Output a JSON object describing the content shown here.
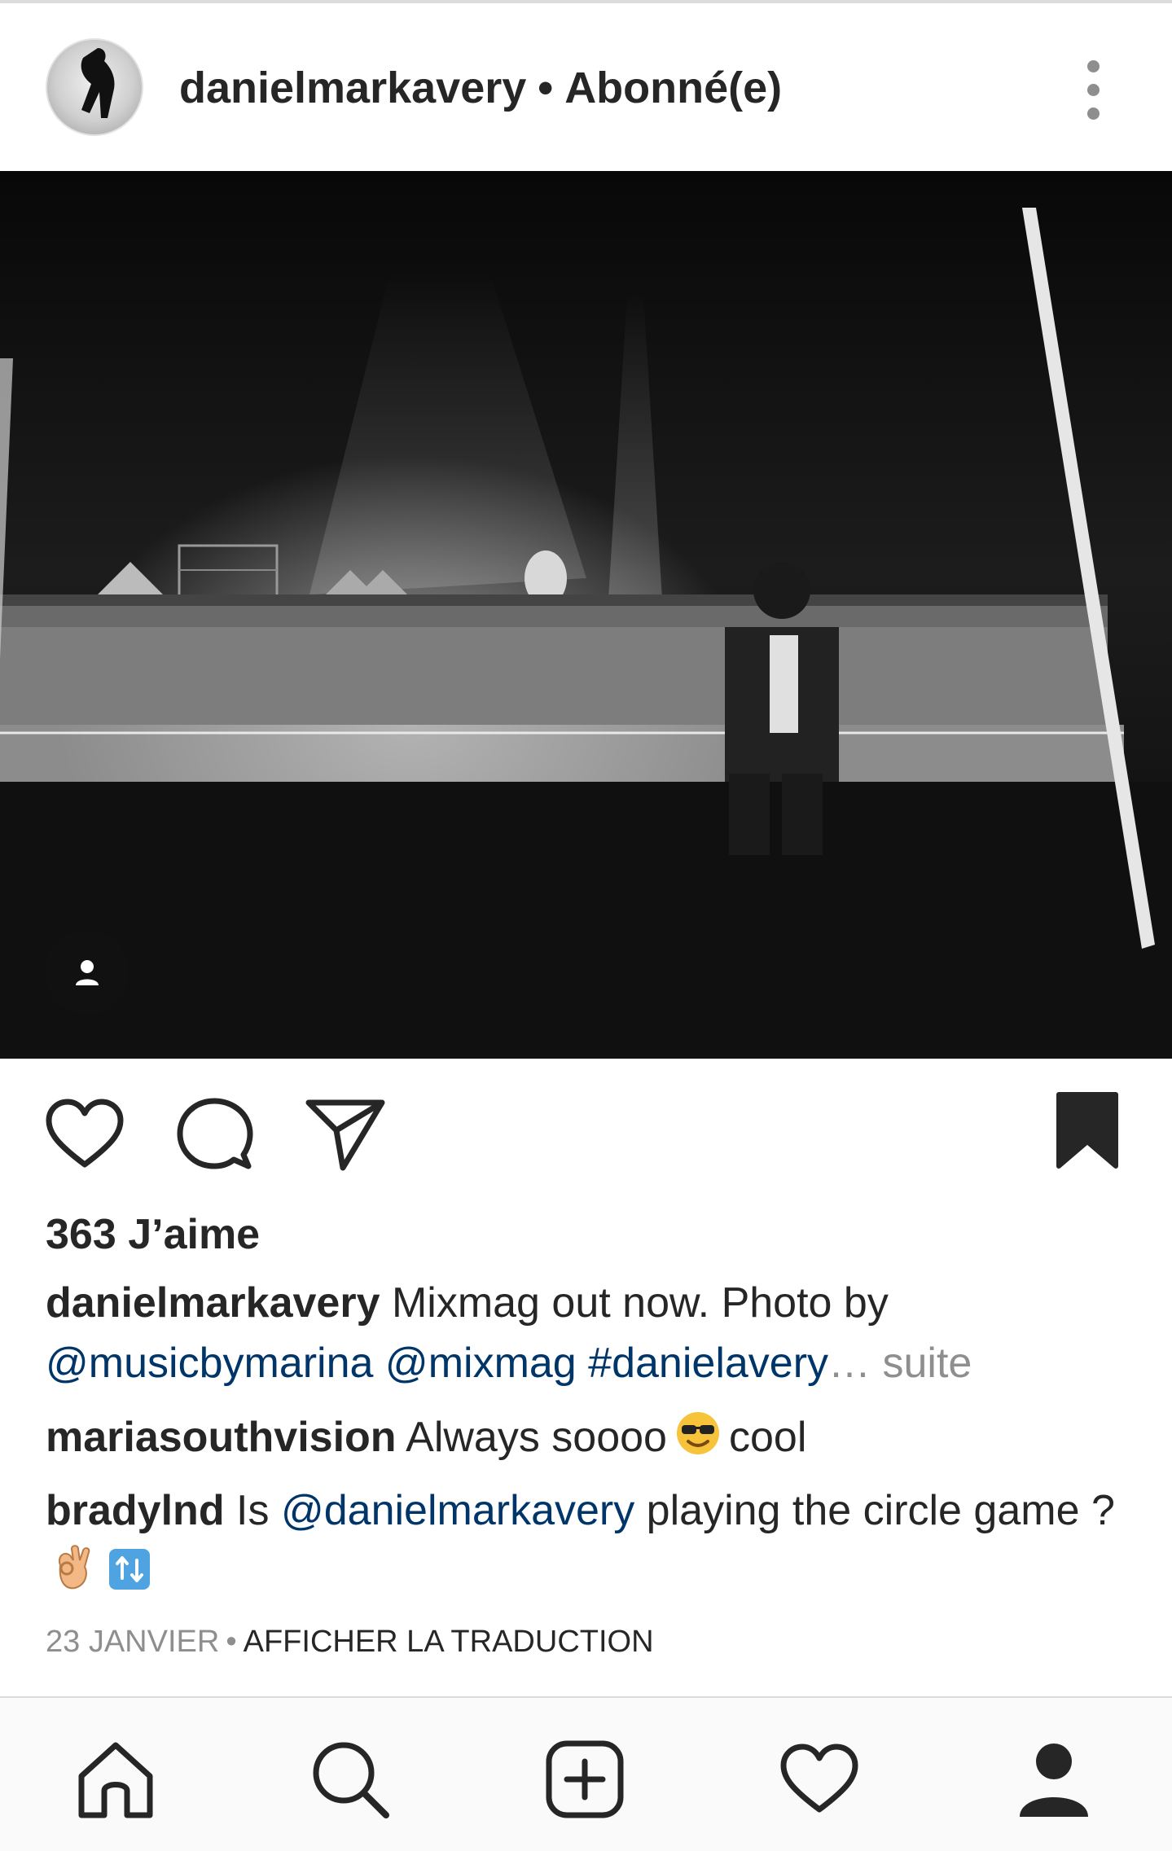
{
  "post": {
    "username": "danielmarkavery",
    "separator": "•",
    "follow_status": "Abonné(e)"
  },
  "likes": "363 J’aime",
  "caption": {
    "username": "danielmarkavery",
    "text": "Mixmag out now. Photo by",
    "mentions": [
      "@musicbymarina",
      "@mixmag",
      "#danielavery"
    ],
    "ellipsis": "…",
    "more": "suite"
  },
  "comments": [
    {
      "username": "mariasouthvision",
      "text_before": "Always soooo",
      "emoji": "sunglasses-face",
      "text_after": "cool"
    },
    {
      "username": "bradylnd",
      "text_before": "Is",
      "mention": "@danielmarkavery",
      "text_after": "playing the circle game ?",
      "emoji_1": "ok-hand",
      "emoji_2": "arrows-button"
    }
  ],
  "meta": {
    "date": "23 JANVIER",
    "separator": "•",
    "translate": "AFFICHER LA TRADUCTION"
  },
  "icons": {
    "more": "more-vertical-icon",
    "tag": "user-tag-icon",
    "like": "heart-icon",
    "comment": "comment-icon",
    "share": "send-icon",
    "save": "bookmark-filled-icon",
    "nav": [
      "home-icon",
      "search-icon",
      "add-post-icon",
      "activity-heart-icon",
      "profile-icon"
    ]
  },
  "colors": {
    "link": "#003569",
    "muted": "#8e8e8e",
    "text": "#262626"
  }
}
